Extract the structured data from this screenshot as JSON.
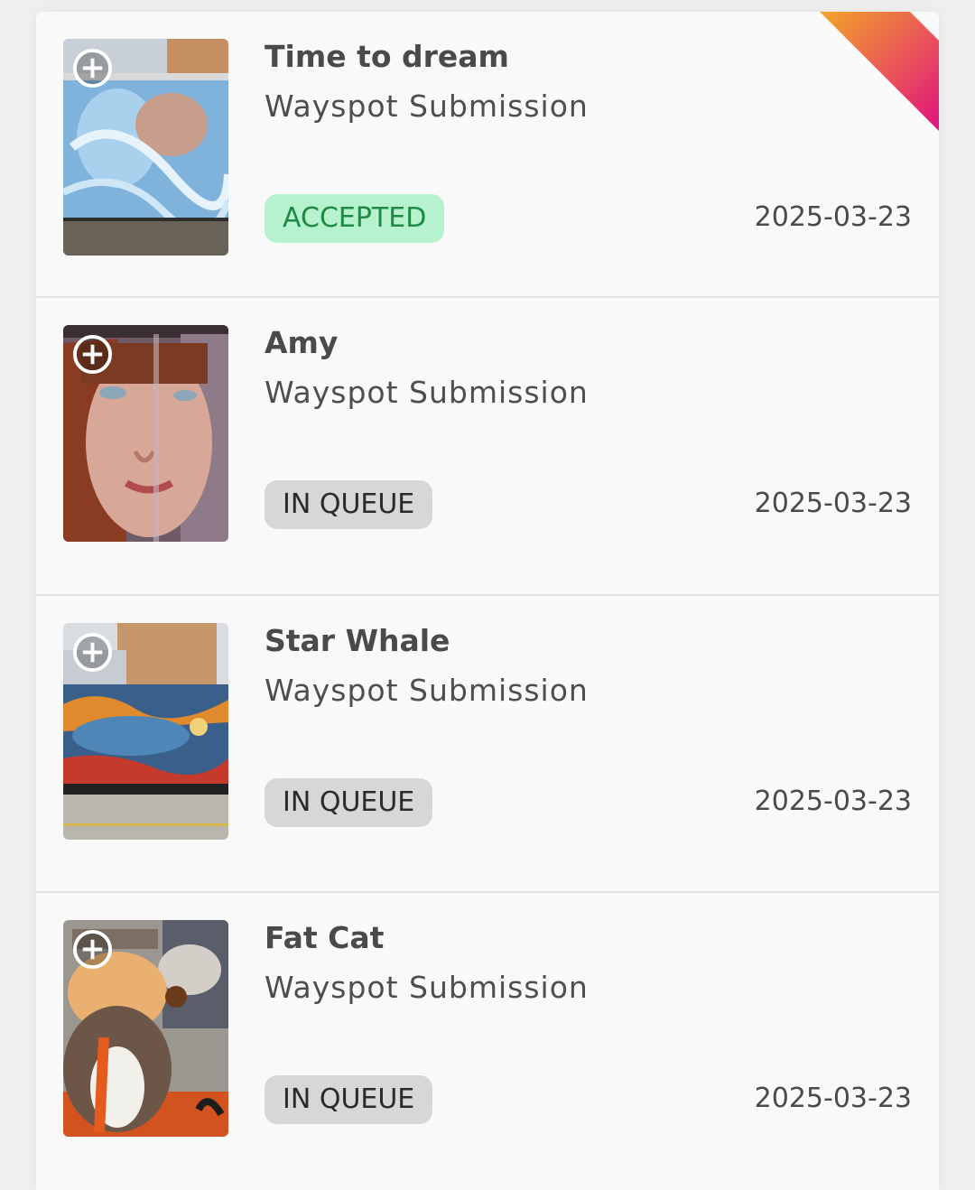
{
  "submissions": [
    {
      "title": "Time to dream",
      "subtitle": "Wayspot Submission",
      "status": "ACCEPTED",
      "status_type": "accepted",
      "date": "2025-03-23",
      "image_icon": "mural-blue-face-image"
    },
    {
      "title": "Amy",
      "subtitle": "Wayspot Submission",
      "status": "IN QUEUE",
      "status_type": "queue",
      "date": "2025-03-23",
      "image_icon": "mural-portrait-image"
    },
    {
      "title": "Star Whale",
      "subtitle": "Wayspot Submission",
      "status": "IN QUEUE",
      "status_type": "queue",
      "date": "2025-03-23",
      "image_icon": "mural-whale-image"
    },
    {
      "title": "Fat Cat",
      "subtitle": "Wayspot Submission",
      "status": "IN QUEUE",
      "status_type": "queue",
      "date": "2025-03-23",
      "image_icon": "mural-cat-image"
    }
  ],
  "colors": {
    "accepted_bg": "#b6f2cd",
    "accepted_text": "#1f8a45",
    "queue_bg": "#d7d7d7",
    "ribbon_start": "#f3a52a",
    "ribbon_end": "#e0137f"
  },
  "icons": {
    "add": "plus-circle-icon",
    "corner": "corner-ribbon"
  }
}
